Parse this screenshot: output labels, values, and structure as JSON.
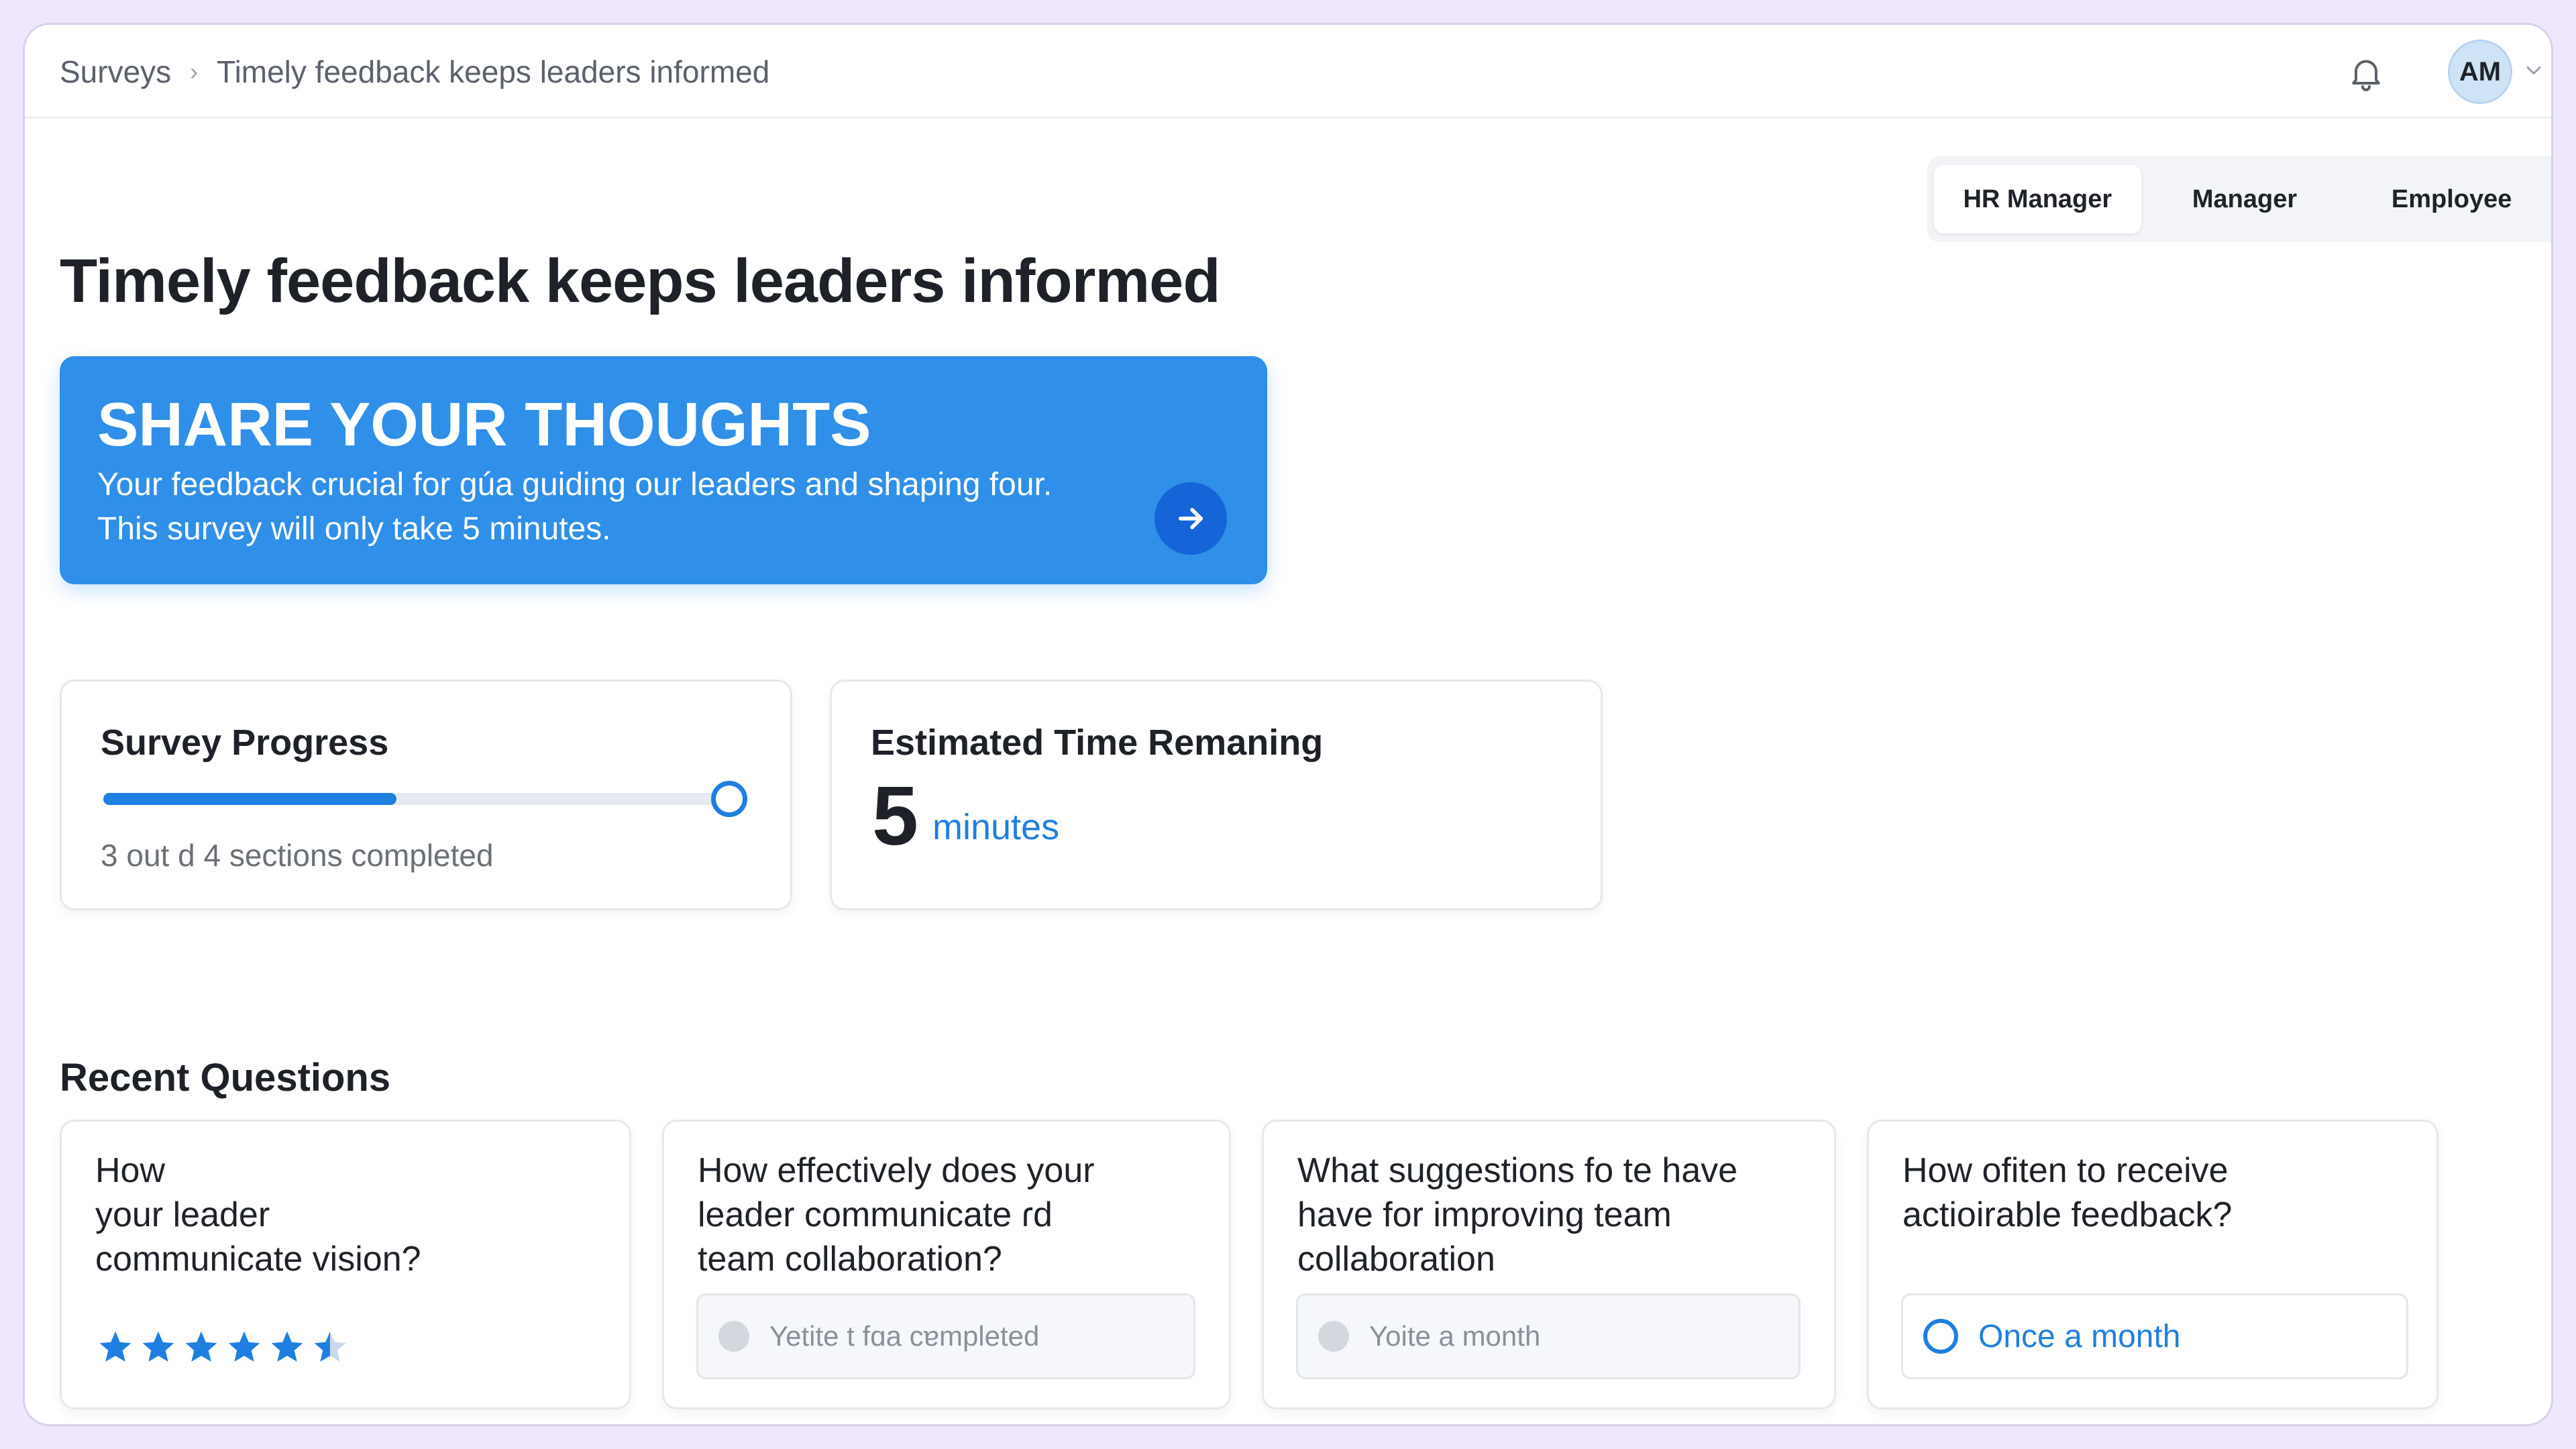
{
  "breadcrumb": {
    "root": "Surveys",
    "current": "Timely feedback keeps leaders informed"
  },
  "user": {
    "initials": "AM"
  },
  "role_tabs": [
    {
      "label": "HR Manager",
      "active": true
    },
    {
      "label": "Manager",
      "active": false
    },
    {
      "label": "Employee",
      "active": false
    }
  ],
  "page_title": "Timely feedback keeps leaders informed",
  "hero": {
    "title": "SHARE YOUR THOUGHTS",
    "line1": "Your feedback crucial for gúa guiding our leaders and shaping four.",
    "line2": "This survey will only take 5 minutes.",
    "icon": "arrow-right-icon"
  },
  "progress": {
    "title": "Survey Progress",
    "text": "3 out d 4 sections completed",
    "completed": 3,
    "total": 4
  },
  "time_remaining": {
    "title": "Estimated Time Remaning",
    "value": "5",
    "unit": "minutes"
  },
  "recent_questions": {
    "title": "Recent Questions",
    "items": [
      {
        "line1": "How",
        "line2": "your leader",
        "line3": "communicate vision?",
        "rating": 5.5,
        "rating_max": 6
      },
      {
        "line1": "How effectively does your",
        "line2": "leader communicate ɾd",
        "line3": "team collaboration?",
        "answer": "Yetite t fɑa cɐmpleted"
      },
      {
        "line1": "What suggestions fo te have",
        "line2": "have for improving team",
        "line3": "collaboration",
        "answer": "Yoite a month"
      },
      {
        "line1": "How ofiten to receive",
        "line2": "actioirable feedback?",
        "answer": "Once a month"
      }
    ]
  },
  "colors": {
    "accent": "#1f7fe0",
    "hero_bg": "#2f8fe9",
    "frame": "#efe7fb"
  }
}
